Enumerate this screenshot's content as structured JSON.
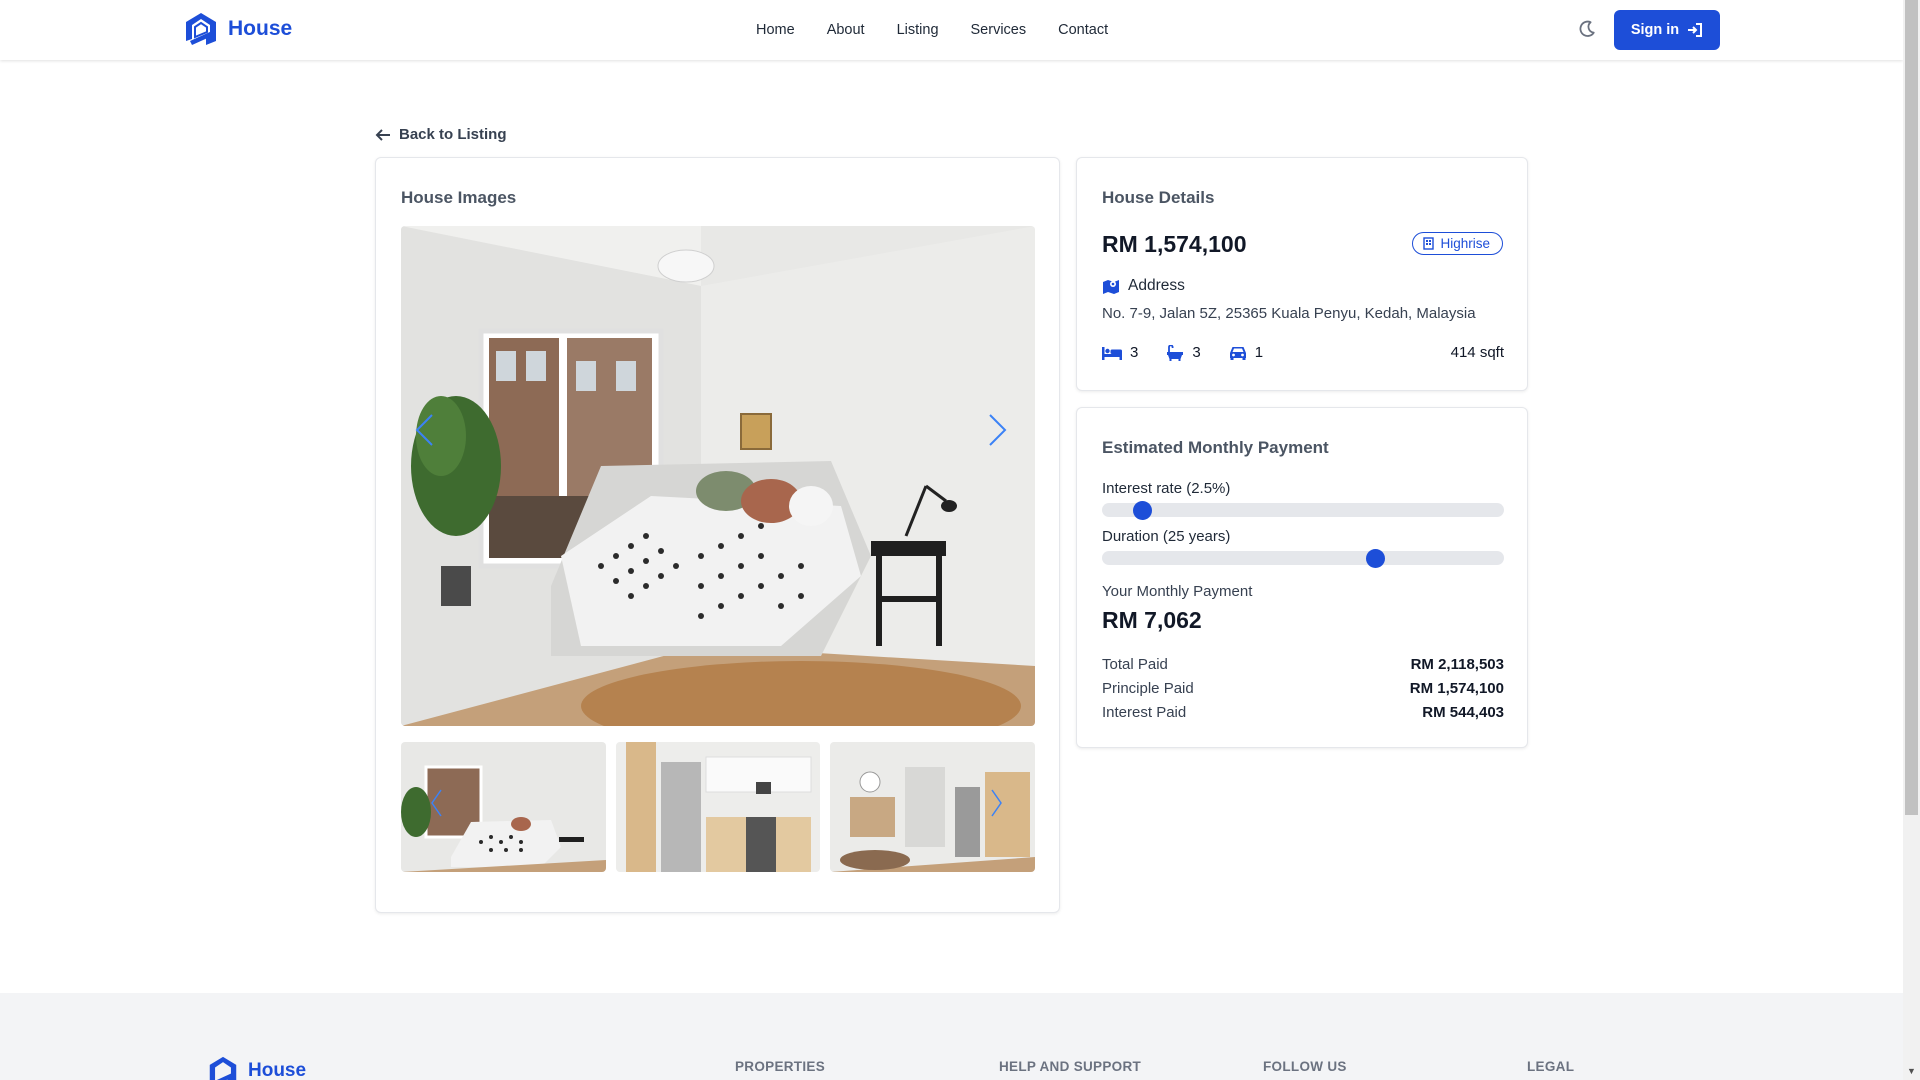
{
  "brand": {
    "name": "House"
  },
  "nav": {
    "links": [
      "Home",
      "About",
      "Listing",
      "Services",
      "Contact"
    ]
  },
  "auth": {
    "signin_label": "Sign in"
  },
  "back": {
    "label": "Back to Listing"
  },
  "images": {
    "title": "House Images",
    "main": "bedroom-photo",
    "thumbnails": [
      "bedroom-photo",
      "kitchen-photo",
      "living-room-photo"
    ]
  },
  "details": {
    "title": "House Details",
    "price": "RM 1,574,100",
    "type": "Highrise",
    "address_label": "Address",
    "address": "No. 7-9, Jalan 5Z, 25365 Kuala Penyu, Kedah, Malaysia",
    "bedrooms": "3",
    "bathrooms": "3",
    "parking": "1",
    "area": "414 sqft"
  },
  "payment": {
    "title": "Estimated Monthly Payment",
    "interest_label": "Interest rate (2.5%)",
    "interest_rate": 2.5,
    "interest_fraction": 0.1,
    "duration_label": "Duration (25 years)",
    "duration_years": 25,
    "duration_fraction": 0.678,
    "monthly_label": "Your Monthly Payment",
    "monthly_value": "RM 7,062",
    "rows": [
      {
        "label": "Total Paid",
        "value": "RM 2,118,503"
      },
      {
        "label": "Principle Paid",
        "value": "RM 1,574,100"
      },
      {
        "label": "Interest Paid",
        "value": "RM 544,403"
      }
    ]
  },
  "footer": {
    "brand": "House",
    "columns": [
      "PROPERTIES",
      "HELP AND SUPPORT",
      "FOLLOW US",
      "LEGAL"
    ]
  },
  "colors": {
    "primary": "#1d4ed8",
    "text": "#1f2937",
    "muted": "#6b7280",
    "footer_bg": "#f3f4f6"
  }
}
